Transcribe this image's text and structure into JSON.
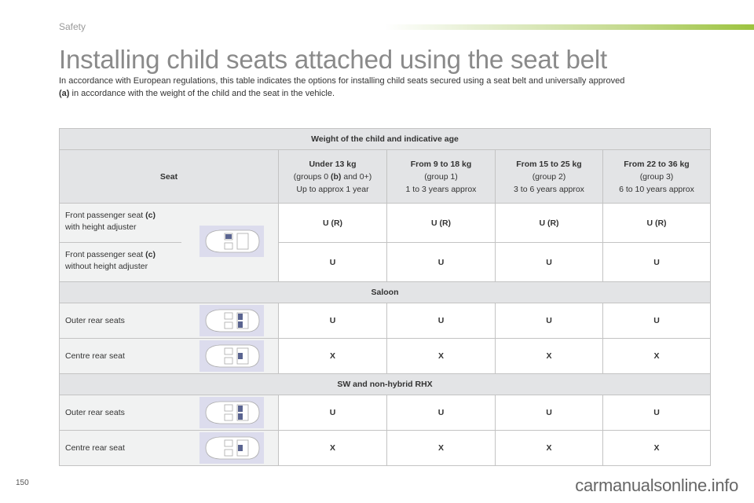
{
  "header": {
    "section": "Safety",
    "accent_color": "#9cc33f"
  },
  "title": "Installing child seats attached using the seat belt",
  "intro": {
    "text_before": "In accordance with European regulations, this table indicates the options for installing child seats secured using a seat belt and universally approved",
    "note": "(a)",
    "text_after": " in accordance with the weight of the child and the seat in the vehicle."
  },
  "table": {
    "top_header": "Weight of the child and indicative age",
    "seat_header": "Seat",
    "columns": [
      {
        "title": "Under 13 kg",
        "group_pre": "(groups 0 ",
        "group_note": "(b)",
        "group_post": " and 0+)",
        "age": "Up to approx 1 year"
      },
      {
        "title": "From 9 to 18 kg",
        "group_pre": "(group 1)",
        "group_note": "",
        "group_post": "",
        "age": "1 to 3 years approx"
      },
      {
        "title": "From 15 to 25 kg",
        "group_pre": "(group 2)",
        "group_note": "",
        "group_post": "",
        "age": "3 to 6 years approx"
      },
      {
        "title": "From 22 to 36 kg",
        "group_pre": "(group 3)",
        "group_note": "",
        "group_post": "",
        "age": "6 to 10 years approx"
      }
    ],
    "front_rows": [
      {
        "label_line1": "Front passenger seat ",
        "note": "(c)",
        "label_line2": "with height adjuster",
        "values": [
          "U (R)",
          "U (R)",
          "U (R)",
          "U (R)"
        ]
      },
      {
        "label_line1": "Front passenger seat ",
        "note": "(c)",
        "label_line2": "without height adjuster",
        "values": [
          "U",
          "U",
          "U",
          "U"
        ]
      }
    ],
    "groups": [
      {
        "name": "Saloon",
        "rows": [
          {
            "label": "Outer rear seats",
            "highlight": "outer-rear-seats",
            "values": [
              "U",
              "U",
              "U",
              "U"
            ]
          },
          {
            "label": "Centre rear seat",
            "highlight": "centre-rear-seat",
            "values": [
              "X",
              "X",
              "X",
              "X"
            ]
          }
        ]
      },
      {
        "name": "SW and non-hybrid RHX",
        "rows": [
          {
            "label": "Outer rear seats",
            "highlight": "outer-rear-seats",
            "values": [
              "U",
              "U",
              "U",
              "U"
            ]
          },
          {
            "label": "Centre rear seat",
            "highlight": "centre-rear-seat",
            "values": [
              "X",
              "X",
              "X",
              "X"
            ]
          }
        ]
      }
    ]
  },
  "footer": {
    "page_number": "150",
    "watermark": "carmanualsonline.info"
  }
}
